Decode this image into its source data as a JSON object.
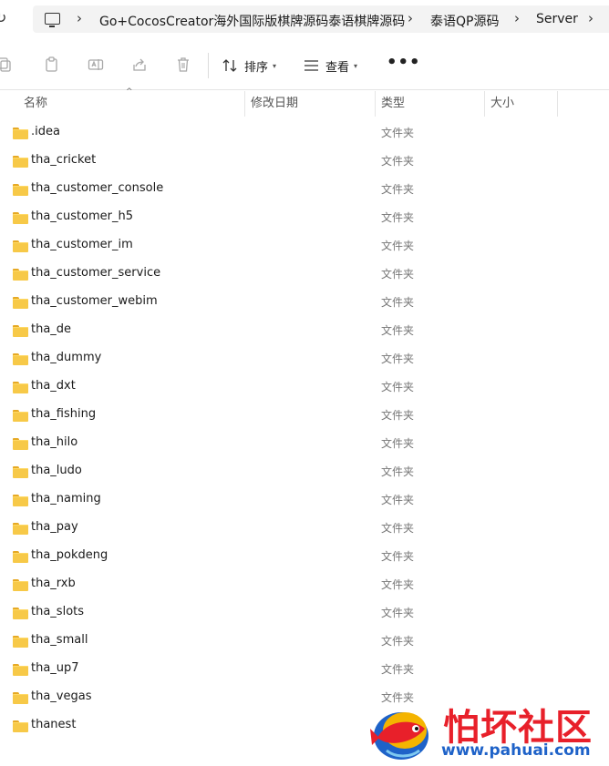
{
  "address_bar": {
    "crumbs": [
      "Go+CocosCreator海外国际版棋牌源码泰语棋牌源码",
      "泰语QP源码",
      "Server"
    ]
  },
  "toolbar": {
    "sort_label": "排序",
    "view_label": "查看",
    "more_label": "•••"
  },
  "columns": {
    "name": "名称",
    "modified": "修改日期",
    "type": "类型",
    "size": "大小"
  },
  "files": [
    {
      "name": ".idea",
      "type": "文件夹"
    },
    {
      "name": "tha_cricket",
      "type": "文件夹"
    },
    {
      "name": "tha_customer_console",
      "type": "文件夹"
    },
    {
      "name": "tha_customer_h5",
      "type": "文件夹"
    },
    {
      "name": "tha_customer_im",
      "type": "文件夹"
    },
    {
      "name": "tha_customer_service",
      "type": "文件夹"
    },
    {
      "name": "tha_customer_webim",
      "type": "文件夹"
    },
    {
      "name": "tha_de",
      "type": "文件夹"
    },
    {
      "name": "tha_dummy",
      "type": "文件夹"
    },
    {
      "name": "tha_dxt",
      "type": "文件夹"
    },
    {
      "name": "tha_fishing",
      "type": "文件夹"
    },
    {
      "name": "tha_hilo",
      "type": "文件夹"
    },
    {
      "name": "tha_ludo",
      "type": "文件夹"
    },
    {
      "name": "tha_naming",
      "type": "文件夹"
    },
    {
      "name": "tha_pay",
      "type": "文件夹"
    },
    {
      "name": "tha_pokdeng",
      "type": "文件夹"
    },
    {
      "name": "tha_rxb",
      "type": "文件夹"
    },
    {
      "name": "tha_slots",
      "type": "文件夹"
    },
    {
      "name": "tha_small",
      "type": "文件夹"
    },
    {
      "name": "tha_up7",
      "type": "文件夹"
    },
    {
      "name": "tha_vegas",
      "type": "文件夹"
    },
    {
      "name": "thanest",
      "type": ""
    }
  ],
  "watermark": {
    "title": "怕坏社区",
    "url": "www.pahuai.com"
  },
  "colors": {
    "folder": "#f7c948",
    "watermark_red": "#e8202a",
    "watermark_blue": "#1e62c8"
  },
  "icons": [
    "refresh-icon",
    "computer-icon",
    "chevron-right-icon",
    "copy-icon",
    "paste-icon",
    "rename-icon",
    "share-icon",
    "delete-icon",
    "sort-icon",
    "view-icon",
    "folder-icon"
  ]
}
